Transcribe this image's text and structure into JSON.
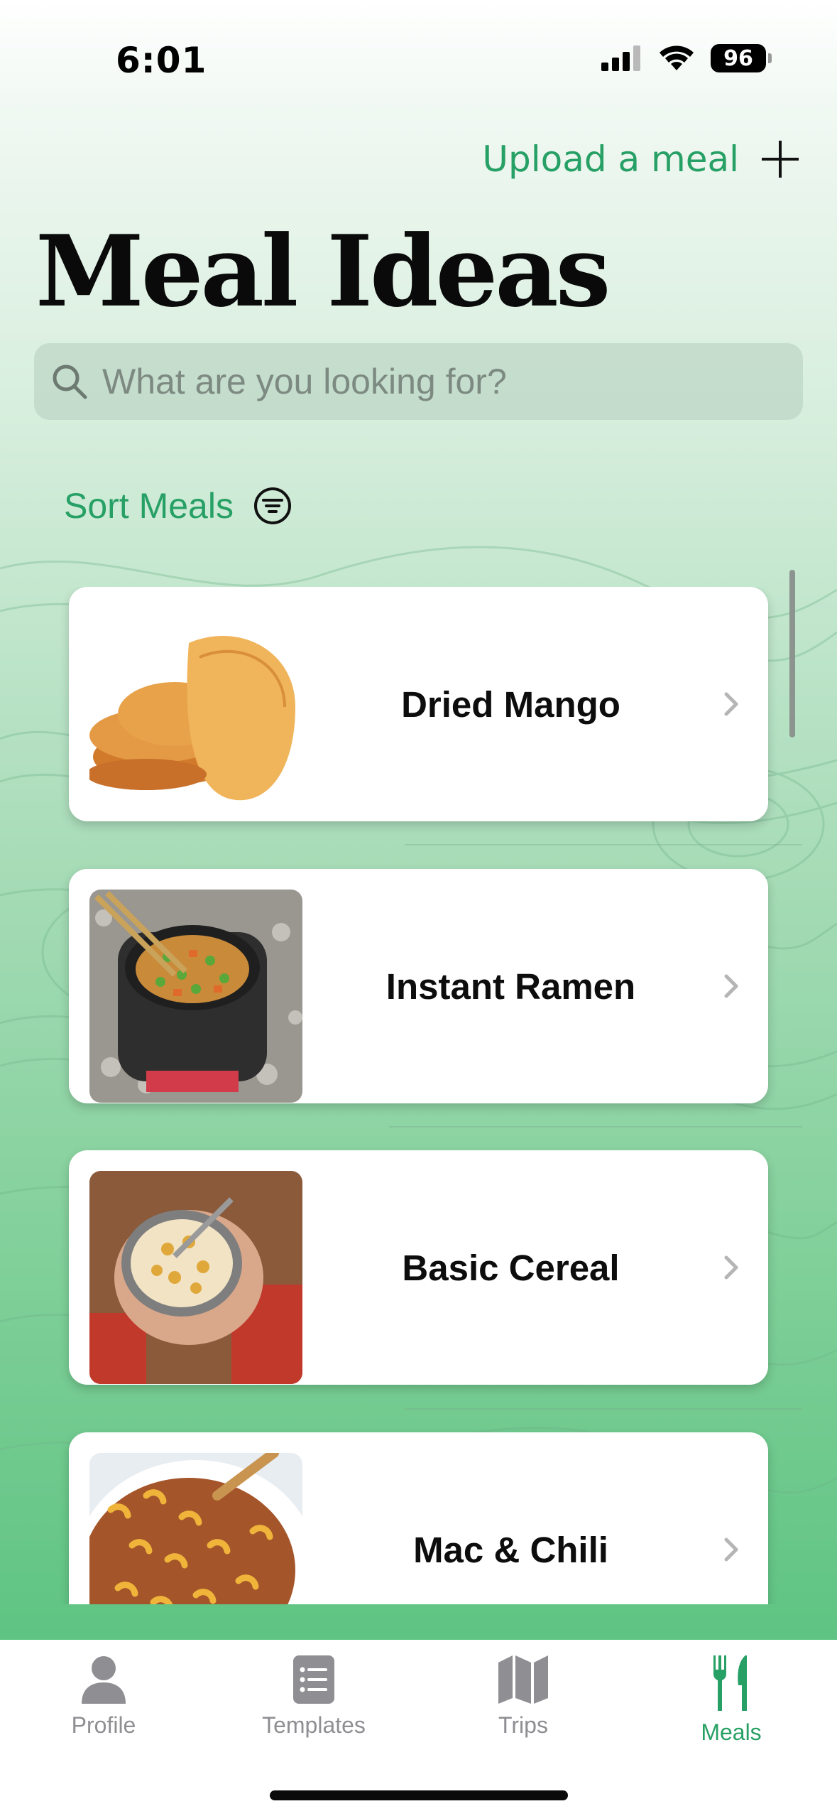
{
  "status": {
    "time": "6:01",
    "battery": "96"
  },
  "header": {
    "upload_label": "Upload a meal",
    "title": "Meal Ideas"
  },
  "search": {
    "placeholder": "What are you looking for?"
  },
  "sort": {
    "label": "Sort Meals"
  },
  "meals": [
    {
      "name": "Dried Mango"
    },
    {
      "name": "Instant Ramen"
    },
    {
      "name": "Basic Cereal"
    },
    {
      "name": "Mac & Chili"
    }
  ],
  "tabs": [
    {
      "label": "Profile",
      "icon": "person-icon",
      "active": false
    },
    {
      "label": "Templates",
      "icon": "list-icon",
      "active": false
    },
    {
      "label": "Trips",
      "icon": "map-icon",
      "active": false
    },
    {
      "label": "Meals",
      "icon": "fork-knife-icon",
      "active": true
    }
  ],
  "colors": {
    "accent": "#27a065",
    "inactive": "#8e8e93"
  }
}
